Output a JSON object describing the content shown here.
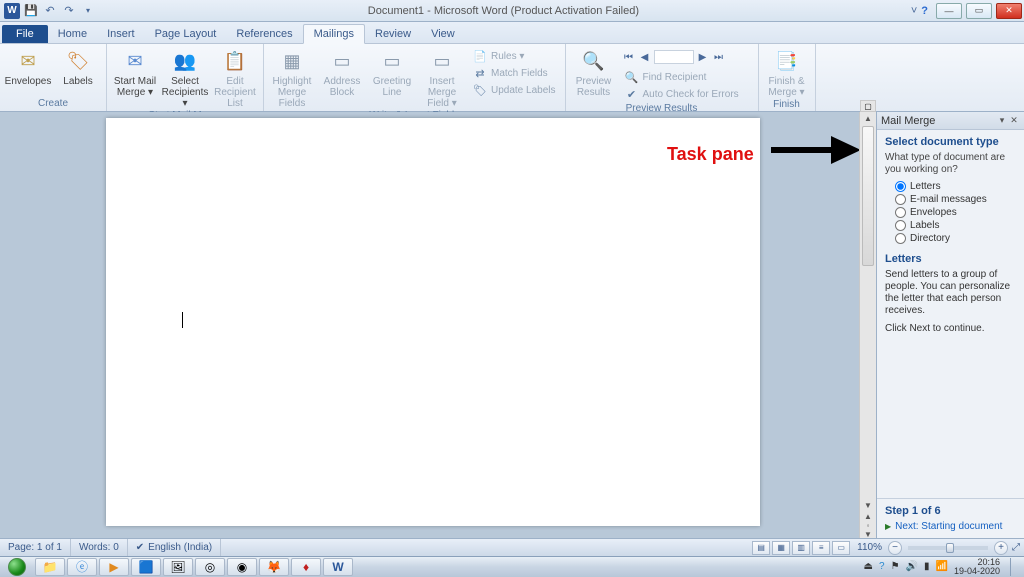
{
  "titlebar": {
    "title": "Document1 - Microsoft Word (Product Activation Failed)"
  },
  "tabs": {
    "file": "File",
    "items": [
      "Home",
      "Insert",
      "Page Layout",
      "References",
      "Mailings",
      "Review",
      "View"
    ],
    "active": 4
  },
  "ribbon": {
    "groups": [
      {
        "label": "Create",
        "big": [
          {
            "name": "envelopes",
            "label": "Envelopes",
            "icon": "✉"
          },
          {
            "name": "labels",
            "label": "Labels",
            "icon": "🏷"
          }
        ]
      },
      {
        "label": "Start Mail Merge",
        "big": [
          {
            "name": "start-mail-merge",
            "label": "Start Mail Merge ▾",
            "icon": "✉"
          },
          {
            "name": "select-recipients",
            "label": "Select Recipients ▾",
            "icon": "👥"
          },
          {
            "name": "edit-recipient-list",
            "label": "Edit Recipient List",
            "icon": "📋",
            "disabled": true
          }
        ]
      },
      {
        "label": "Write & Insert Fields",
        "big": [
          {
            "name": "highlight-merge-fields",
            "label": "Highlight Merge Fields",
            "icon": "▦",
            "disabled": true
          },
          {
            "name": "address-block",
            "label": "Address Block",
            "icon": "▭",
            "disabled": true
          },
          {
            "name": "greeting-line",
            "label": "Greeting Line",
            "icon": "▭",
            "disabled": true
          },
          {
            "name": "insert-merge-field",
            "label": "Insert Merge Field ▾",
            "icon": "▭",
            "disabled": true
          }
        ],
        "small": [
          {
            "name": "rules",
            "label": "Rules ▾",
            "icon": "📄",
            "disabled": true
          },
          {
            "name": "match-fields",
            "label": "Match Fields",
            "icon": "⇄",
            "disabled": true
          },
          {
            "name": "update-labels",
            "label": "Update Labels",
            "icon": "🏷",
            "disabled": true
          }
        ]
      },
      {
        "label": "Preview Results",
        "big": [
          {
            "name": "preview-results",
            "label": "Preview Results",
            "icon": "🔍",
            "disabled": true
          }
        ],
        "nav": [
          "⏮",
          "◀",
          "",
          "▶",
          "⏭"
        ],
        "small": [
          {
            "name": "find-recipient",
            "label": "Find Recipient",
            "icon": "🔍",
            "disabled": true
          },
          {
            "name": "auto-check",
            "label": "Auto Check for Errors",
            "icon": "✔",
            "disabled": true
          }
        ]
      },
      {
        "label": "Finish",
        "big": [
          {
            "name": "finish-merge",
            "label": "Finish & Merge ▾",
            "icon": "📑",
            "disabled": true
          }
        ]
      }
    ]
  },
  "taskpane": {
    "title": "Mail Merge",
    "section1_title": "Select document type",
    "question": "What type of document are you working on?",
    "options": [
      "Letters",
      "E-mail messages",
      "Envelopes",
      "Labels",
      "Directory"
    ],
    "selected": 0,
    "section2_title": "Letters",
    "section2_desc": "Send letters to a group of people. You can personalize the letter that each person receives.",
    "continue": "Click Next to continue.",
    "step": "Step 1 of 6",
    "next": "Next: Starting document"
  },
  "annotation": {
    "label": "Task pane"
  },
  "status": {
    "page": "Page: 1 of 1",
    "words": "Words: 0",
    "lang": "English (India)",
    "zoom": "110%"
  },
  "taskbar": {
    "time": "20:16",
    "date": "19-04-2020"
  }
}
